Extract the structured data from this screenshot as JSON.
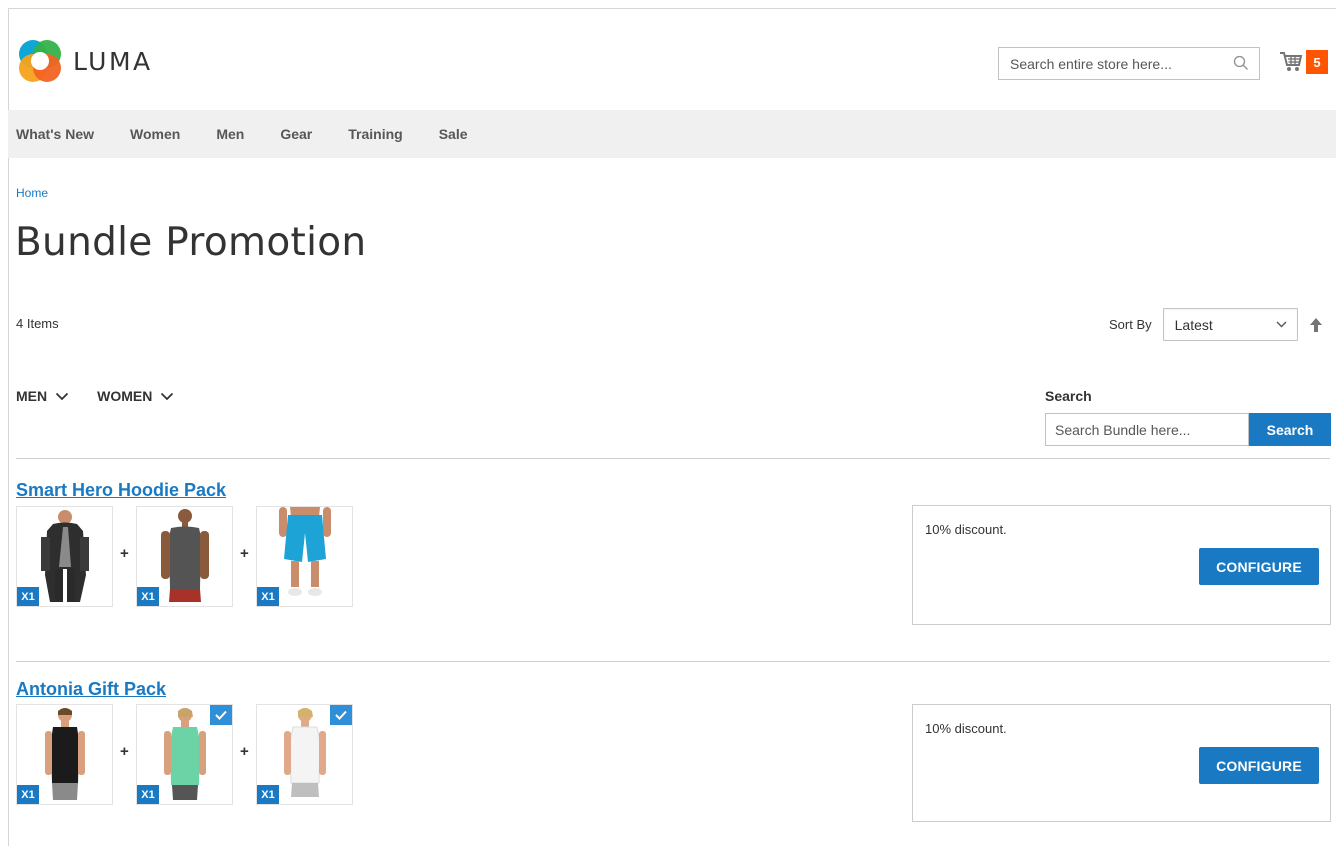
{
  "brand": {
    "name": "LUMA"
  },
  "header": {
    "search_placeholder": "Search entire store here...",
    "cart_count": "5"
  },
  "nav": {
    "items": [
      {
        "label": "What's New"
      },
      {
        "label": "Women"
      },
      {
        "label": "Men"
      },
      {
        "label": "Gear"
      },
      {
        "label": "Training"
      },
      {
        "label": "Sale"
      }
    ]
  },
  "breadcrumb": {
    "home": "Home"
  },
  "page": {
    "title": "Bundle Promotion",
    "items_count": "4 Items"
  },
  "sorter": {
    "label": "Sort By",
    "selected": "Latest"
  },
  "filters": {
    "items": [
      {
        "label": "MEN"
      },
      {
        "label": "WOMEN"
      }
    ]
  },
  "side_search": {
    "title": "Search",
    "placeholder": "Search Bundle here...",
    "button": "Search"
  },
  "bundles": [
    {
      "title": "Smart Hero Hoodie Pack",
      "promo": "10% discount.",
      "button": "CONFIGURE",
      "products": [
        {
          "qty": "X1",
          "checked": false,
          "icon": "hoodie-icon"
        },
        {
          "qty": "X1",
          "checked": false,
          "icon": "tank-top-icon"
        },
        {
          "qty": "X1",
          "checked": false,
          "icon": "shorts-icon"
        }
      ]
    },
    {
      "title": "Antonia Gift Pack",
      "promo": "10% discount.",
      "button": "CONFIGURE",
      "products": [
        {
          "qty": "X1",
          "checked": false,
          "icon": "tank-top-icon"
        },
        {
          "qty": "X1",
          "checked": true,
          "icon": "tank-top-icon"
        },
        {
          "qty": "X1",
          "checked": true,
          "icon": "tank-top-icon"
        }
      ]
    }
  ],
  "colors": {
    "accent": "#1979c3",
    "cart_badge": "#ff5501",
    "nav_bg": "#f0f0f0"
  }
}
